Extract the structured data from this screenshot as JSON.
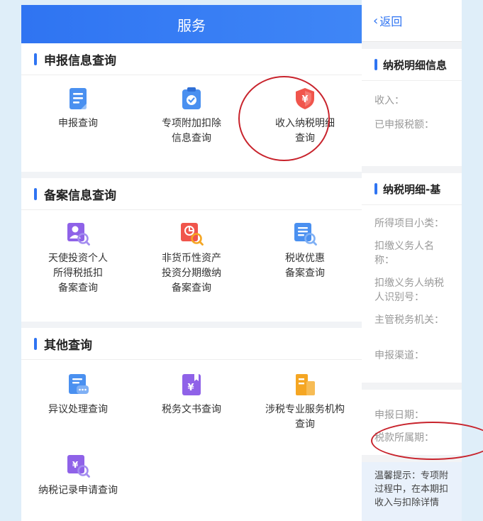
{
  "left": {
    "title": "服务",
    "sections": [
      {
        "title": "申报信息查询",
        "items": [
          {
            "label": "申报查询",
            "icon": "document-icon"
          },
          {
            "label": "专项附加扣除\n信息查询",
            "icon": "clipboard-check-icon"
          },
          {
            "label": "收入纳税明细\n查询",
            "icon": "yuan-shield-icon"
          }
        ]
      },
      {
        "title": "备案信息查询",
        "items": [
          {
            "label": "天使投资个人\n所得税抵扣\n备案查询",
            "icon": "person-search-icon"
          },
          {
            "label": "非货币性资产\n投资分期缴纳\n备案查询",
            "icon": "chart-search-icon"
          },
          {
            "label": "税收优惠\n备案查询",
            "icon": "list-search-icon"
          }
        ]
      },
      {
        "title": "其他查询",
        "items": [
          {
            "label": "异议处理查询",
            "icon": "chat-doc-icon"
          },
          {
            "label": "税务文书查询",
            "icon": "yuan-book-icon"
          },
          {
            "label": "涉税专业服务机构\n查询",
            "icon": "building-icon"
          },
          {
            "label": "纳税记录申请查询",
            "icon": "yuan-search-icon"
          }
        ]
      }
    ]
  },
  "right": {
    "back": "返回",
    "section1": {
      "title": "纳税明细信息",
      "fields": [
        "收入：",
        "已申报税额："
      ]
    },
    "section2": {
      "title": "纳税明细-基",
      "fields": [
        "所得项目小类：",
        "扣缴义务人名\n称：",
        "扣缴义务人纳税\n人识别号：",
        "主管税务机关：",
        "申报渠道："
      ]
    },
    "section3": {
      "fields": [
        "申报日期：",
        "税款所属期："
      ]
    },
    "tip": "温馨提示：专项附\n过程中，在本期扣\n收入与扣除详情"
  },
  "colors": {
    "brand_blue": "#2f74f2",
    "annotation_red": "#c8232c",
    "icon_blue": "#4a90f0",
    "icon_purple": "#8f62e8",
    "icon_red": "#f0554c",
    "icon_orange": "#f5a623"
  }
}
